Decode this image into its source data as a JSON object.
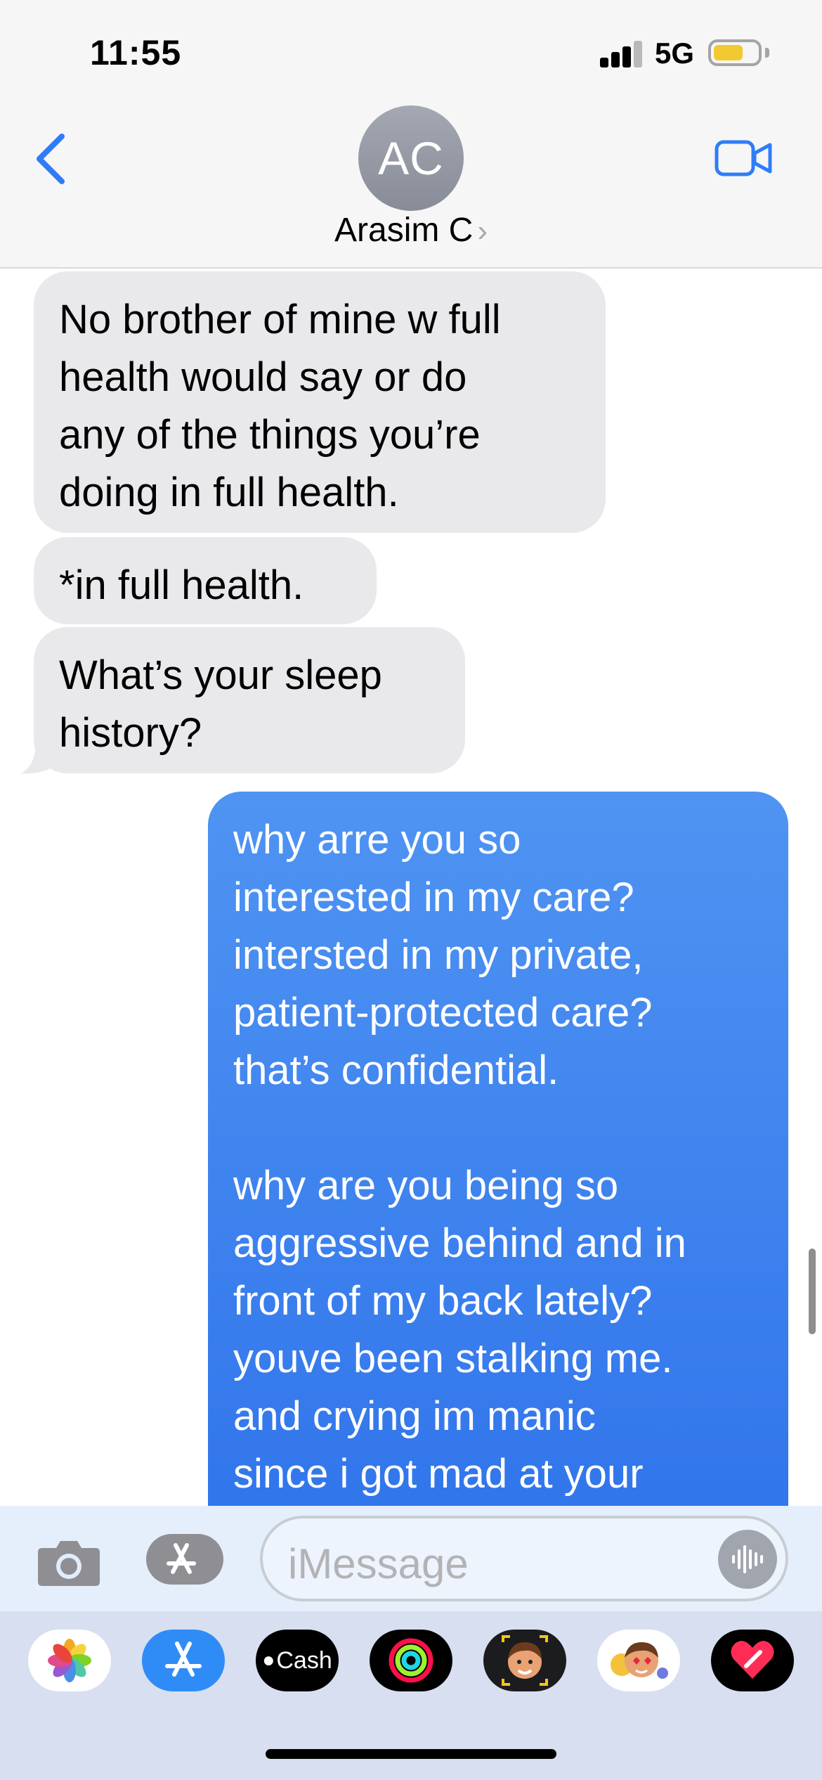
{
  "status_bar": {
    "time": "11:55",
    "network": "5G",
    "battery_level": 0.68,
    "signal_bars_filled": 3
  },
  "header": {
    "avatar_initials": "AC",
    "contact_name": "Arasim C",
    "contact_chevron": "›",
    "back_icon": "chevron-left-icon",
    "video_icon": "video-camera-icon",
    "accent_color": "#2f7cf6"
  },
  "messages": [
    {
      "direction": "incoming",
      "text": "No brother of mine w full\nhealth would say or do\nany of the things you’re\ndoing in full health."
    },
    {
      "direction": "incoming",
      "text": "*in full health."
    },
    {
      "direction": "incoming",
      "text": "What’s your sleep\nhistory?"
    },
    {
      "direction": "outgoing",
      "text": "why arre you so\ninterested in my care?\nintersted in my private,\npatient-protected care?\nthat’s confidential.\n\nwhy are you being so\naggressive behind and in\nfront of my back lately?\nyouve been stalking me.\nand crying im manic\nsince i got mad at your"
    }
  ],
  "compose": {
    "placeholder": "iMessage",
    "camera_icon": "camera-icon",
    "apps_icon": "app-store-icon",
    "mic_icon": "waveform-icon"
  },
  "app_drawer": {
    "apps": [
      {
        "name": "photos-app-icon"
      },
      {
        "name": "app-store-app-icon"
      },
      {
        "name": "apple-cash-app-icon",
        "label": "Cash"
      },
      {
        "name": "fitness-activity-app-icon"
      },
      {
        "name": "memoji-app-icon"
      },
      {
        "name": "memoji-stickers-app-icon"
      },
      {
        "name": "digital-touch-app-icon"
      }
    ]
  },
  "colors": {
    "incoming_bubble": "#e9e9eb",
    "outgoing_bubble_top": "#4f94f2",
    "outgoing_bubble_bottom": "#2f73eb"
  }
}
